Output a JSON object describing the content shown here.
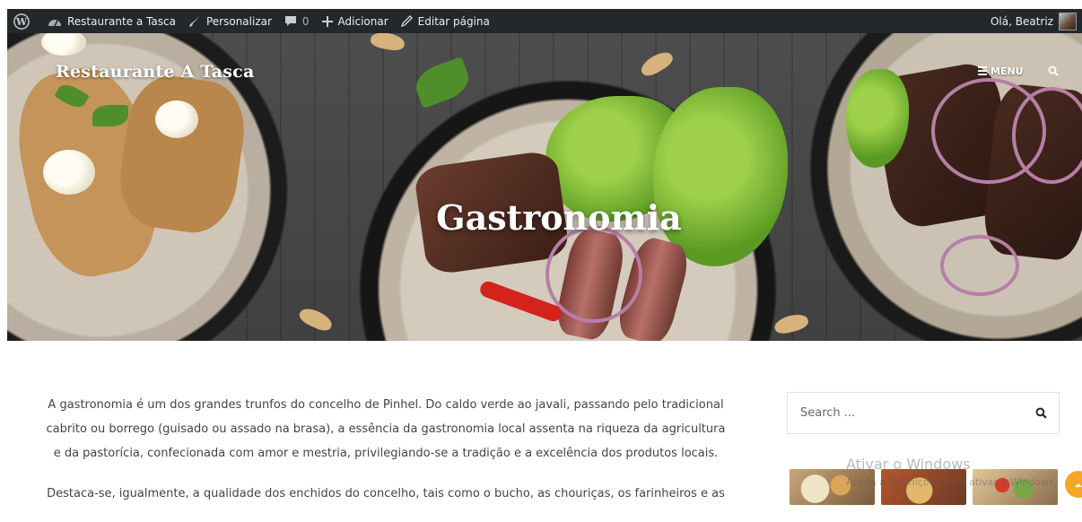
{
  "admin_bar": {
    "site_name": "Restaurante a Tasca",
    "customize": "Personalizar",
    "comments_count": "0",
    "add_new": "Adicionar",
    "edit_page": "Editar página",
    "greeting": "Olá, Beatriz"
  },
  "header": {
    "site_title": "Restaurante A Tasca",
    "menu_label": "MENU"
  },
  "page": {
    "title": "Gastronomia",
    "paragraphs": [
      "A gastronomia é um dos grandes trunfos do concelho de Pinhel. Do caldo verde ao javali, passando pelo tradicional cabrito ou borrego (guisado ou assado na brasa), a essência da gastronomia local assenta na riqueza da agricultura e da pastorícia, confecionada com amor e mestria, privilegiando-se a tradição e a excelência dos produtos locais.",
      "Destaca-se, igualmente, a qualidade dos enchidos do concelho, tais como o bucho, as chouriças, os farinheiros e as"
    ]
  },
  "sidebar": {
    "search_placeholder": "Search ..."
  },
  "overlay": {
    "watermark_title": "Ativar o Windows",
    "watermark_sub": "Aceda a Definições para ativar o Windows."
  },
  "colors": {
    "admin_bar_bg": "#23282d",
    "scroll_top": "#f5a623"
  }
}
